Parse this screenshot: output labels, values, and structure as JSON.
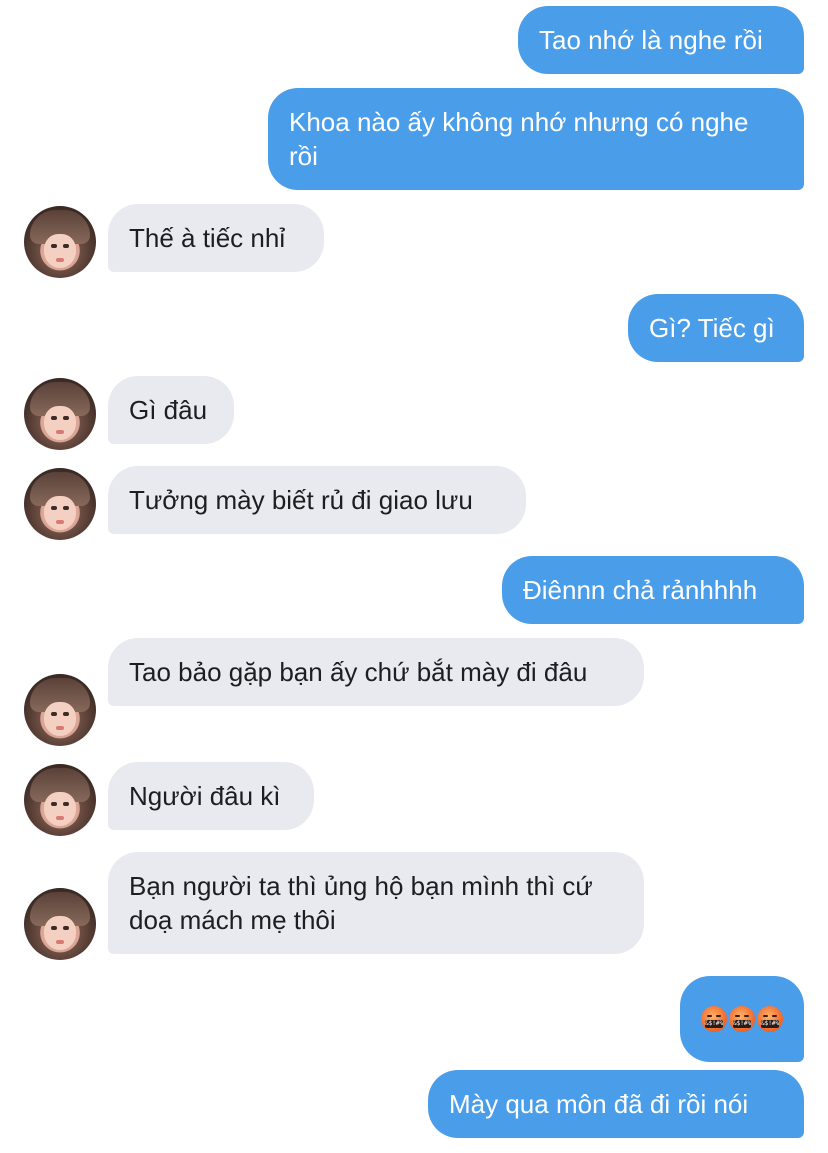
{
  "conversation": {
    "messages": [
      {
        "sender": "me",
        "text": "Tao nhớ là nghe rồi"
      },
      {
        "sender": "me",
        "text": "Khoa nào ấy không nhớ nhưng có nghe rồi"
      },
      {
        "sender": "them",
        "text": "Thế à tiếc nhỉ"
      },
      {
        "sender": "me",
        "text": "Gì? Tiếc gì"
      },
      {
        "sender": "them",
        "text": "Gì đâu"
      },
      {
        "sender": "them",
        "text": "Tưởng mày biết rủ đi giao lưu"
      },
      {
        "sender": "me",
        "text": "Điênnn chả rảnhhhh"
      },
      {
        "sender": "them",
        "text": "Tao bảo gặp bạn ấy chứ bắt mày đi đâu"
      },
      {
        "sender": "them",
        "text": "Người đâu kì"
      },
      {
        "sender": "them",
        "text": "Bạn người ta thì ủng hộ bạn mình thì cứ doạ mách mẹ thôi"
      },
      {
        "sender": "me",
        "emoji": [
          "face-with-symbols-on-mouth",
          "face-with-symbols-on-mouth",
          "face-with-symbols-on-mouth"
        ],
        "emoji_glyph": "&$!#%"
      },
      {
        "sender": "me",
        "text": "Mày qua môn đã đi rồi nói"
      }
    ]
  },
  "colors": {
    "outgoing_bubble": "#4a9ee9",
    "incoming_bubble": "#e8eaef",
    "background": "#ffffff"
  }
}
